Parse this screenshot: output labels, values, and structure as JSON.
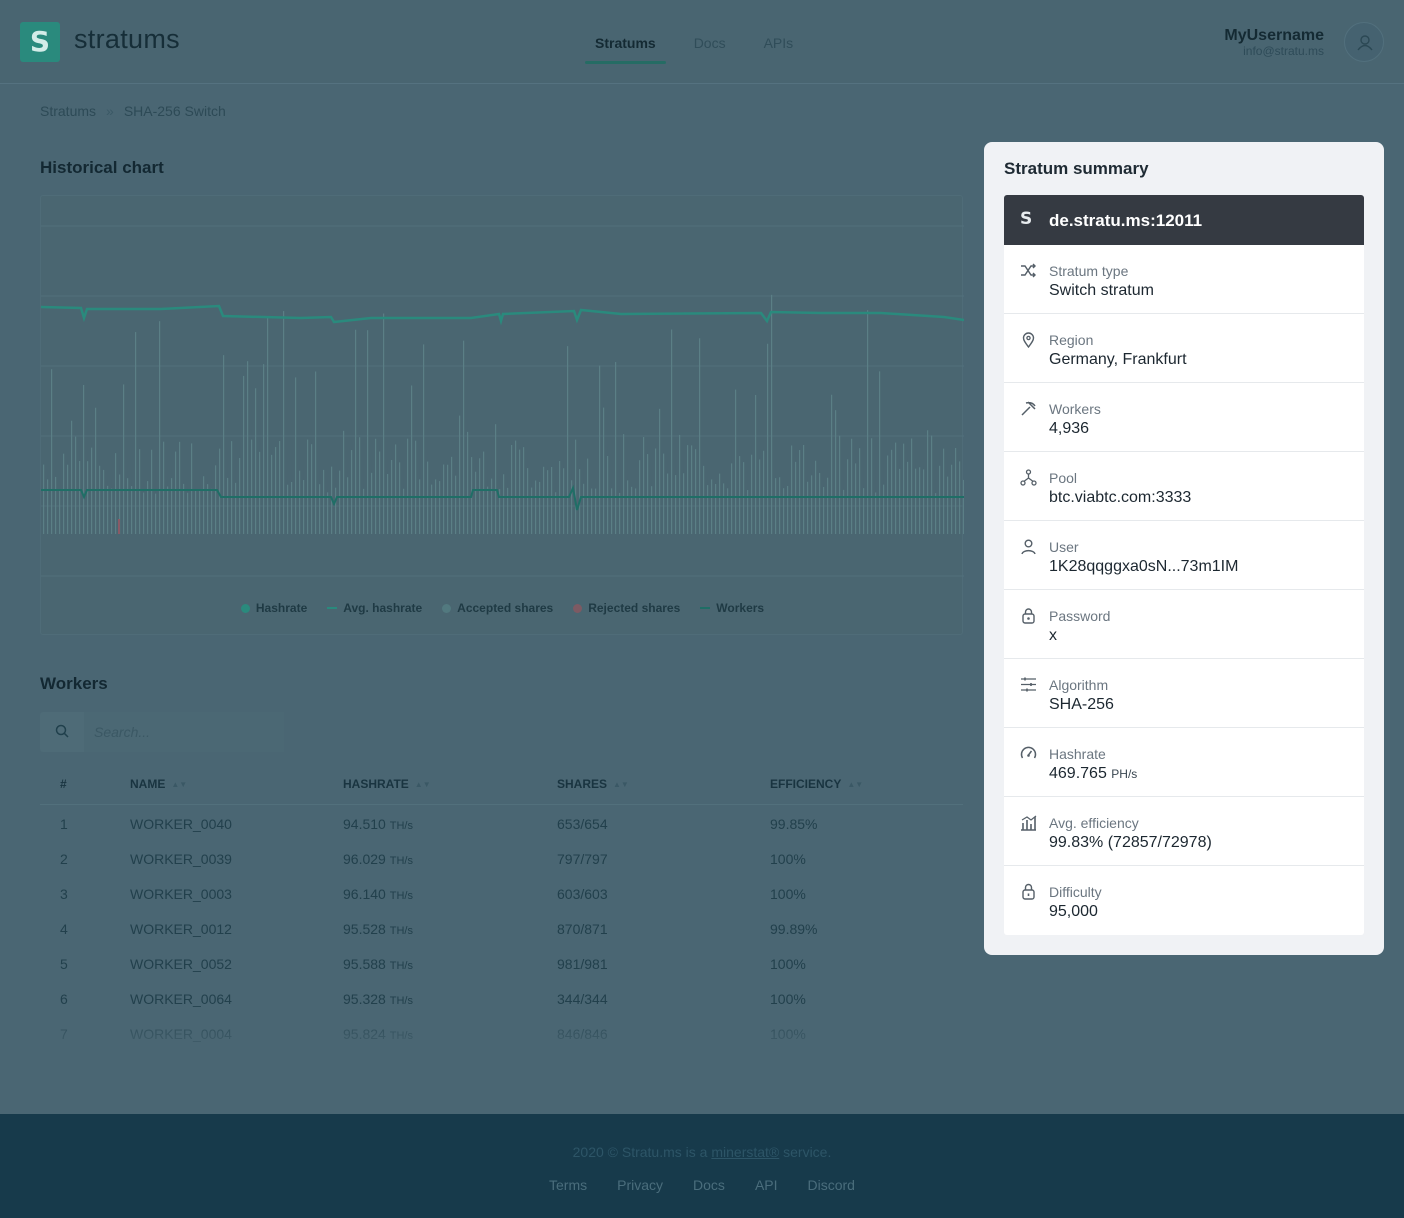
{
  "header": {
    "brand": "stratums",
    "nav": [
      "Stratums",
      "Docs",
      "APIs"
    ],
    "user_name": "MyUsername",
    "user_email": "info@stratu.ms"
  },
  "breadcrumb": [
    "Stratums",
    "SHA-256 Switch"
  ],
  "historical": {
    "title": "Historical chart",
    "legend": [
      "Hashrate",
      "Avg. hashrate",
      "Accepted shares",
      "Rejected shares",
      "Workers"
    ]
  },
  "chart_data": {
    "type": "line",
    "series": [
      {
        "name": "Hashrate",
        "color": "#2a8a7d"
      },
      {
        "name": "Avg. hashrate",
        "color": "#2a8a7d"
      },
      {
        "name": "Accepted shares",
        "color": "#52797f"
      },
      {
        "name": "Rejected shares",
        "color": "#7d5a63"
      },
      {
        "name": "Workers",
        "color": "#1f6e66"
      }
    ]
  },
  "workers": {
    "title": "Workers",
    "search_placeholder": "Search...",
    "columns": [
      "#",
      "NAME",
      "HASHRATE",
      "SHARES",
      "EFFICIENCY"
    ],
    "rows": [
      {
        "idx": "1",
        "name": "WORKER_0040",
        "hashrate": "94.510",
        "unit": "TH/s",
        "shares": "653/654",
        "eff": "99.85%"
      },
      {
        "idx": "2",
        "name": "WORKER_0039",
        "hashrate": "96.029",
        "unit": "TH/s",
        "shares": "797/797",
        "eff": "100%"
      },
      {
        "idx": "3",
        "name": "WORKER_0003",
        "hashrate": "96.140",
        "unit": "TH/s",
        "shares": "603/603",
        "eff": "100%"
      },
      {
        "idx": "4",
        "name": "WORKER_0012",
        "hashrate": "95.528",
        "unit": "TH/s",
        "shares": "870/871",
        "eff": "99.89%"
      },
      {
        "idx": "5",
        "name": "WORKER_0052",
        "hashrate": "95.588",
        "unit": "TH/s",
        "shares": "981/981",
        "eff": "100%"
      },
      {
        "idx": "6",
        "name": "WORKER_0064",
        "hashrate": "95.328",
        "unit": "TH/s",
        "shares": "344/344",
        "eff": "100%"
      },
      {
        "idx": "7",
        "name": "WORKER_0004",
        "hashrate": "95.824",
        "unit": "TH/s",
        "shares": "846/846",
        "eff": "100%"
      }
    ]
  },
  "summary": {
    "title": "Stratum summary",
    "host": "de.stratu.ms:12011",
    "items": [
      {
        "label": "Stratum type",
        "value": "Switch stratum",
        "icon": "shuffle-icon"
      },
      {
        "label": "Region",
        "value": "Germany, Frankfurt",
        "icon": "map-pin-icon"
      },
      {
        "label": "Workers",
        "value": "4,936",
        "icon": "pickaxe-icon"
      },
      {
        "label": "Pool",
        "value": "btc.viabtc.com:3333",
        "icon": "network-icon"
      },
      {
        "label": "User",
        "value": "1K28qqggxa0sN...73m1IM",
        "icon": "user-icon"
      },
      {
        "label": "Password",
        "value": "x",
        "icon": "lock-icon"
      },
      {
        "label": "Algorithm",
        "value": "SHA-256",
        "icon": "sliders-icon"
      },
      {
        "label": "Hashrate",
        "value": "469.765",
        "unit": "PH/s",
        "icon": "gauge-icon"
      },
      {
        "label": "Avg. efficiency",
        "value": "99.83% (72857/72978)",
        "icon": "chart-icon"
      },
      {
        "label": "Difficulty",
        "value": "95,000",
        "icon": "padlock-icon"
      }
    ]
  },
  "footer": {
    "copy_pre": "2020 © Stratu.ms is a",
    "copy_link": "minerstat®",
    "copy_post": "service.",
    "links": [
      "Terms",
      "Privacy",
      "Docs",
      "API",
      "Discord"
    ]
  }
}
